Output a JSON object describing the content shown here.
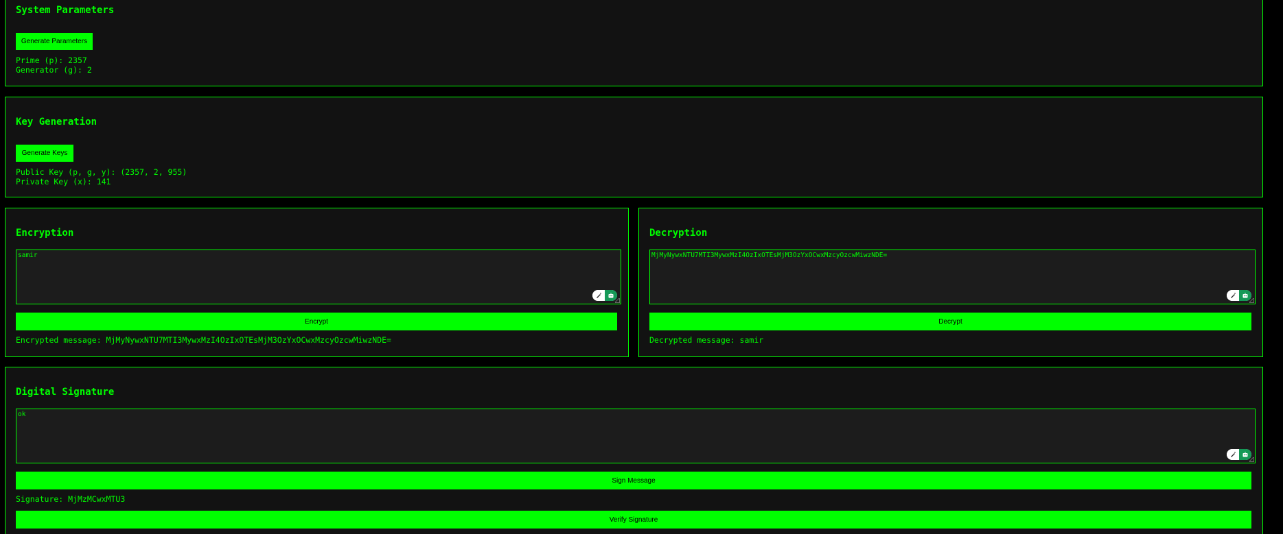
{
  "colors": {
    "page_background": "#000000",
    "panel_background": "#121212",
    "accent": "#00ff00",
    "textarea_background": "#1c1c1c",
    "button_text": "#000000"
  },
  "system_parameters": {
    "title": "System Parameters",
    "button_label": "Generate Parameters",
    "prime": "Prime (p): 2357",
    "generator": "Generator (g): 2"
  },
  "key_generation": {
    "title": "Key Generation",
    "button_label": "Generate Keys",
    "public_key": "Public Key (p, g, y): (2357, 2, 955)",
    "private_key": "Private Key (x): 141"
  },
  "encryption": {
    "title": "Encryption",
    "input_value": "samir",
    "button_label": "Encrypt",
    "result": "Encrypted message: MjMyNywxNTU7MTI3MywxMzI4OzIxOTEsMjM3OzYxOCwxMzcyOzcwMiwzNDE="
  },
  "decryption": {
    "title": "Decryption",
    "input_value": "MjMyNywxNTU7MTI3MywxMzI4OzIxOTEsMjM3OzYxOCwxMzcyOzcwMiwzNDE=",
    "button_label": "Decrypt",
    "result": "Decrypted message: samir"
  },
  "digital_signature": {
    "title": "Digital Signature",
    "input_value": "ok",
    "sign_button_label": "Sign Message",
    "signature": "Signature: MjMzMCwxMTU3",
    "verify_button_label": "Verify Signature"
  },
  "icons": {
    "extension_left": "pen-icon",
    "extension_right": "robot-icon",
    "resize": "resize-grip-icon"
  }
}
